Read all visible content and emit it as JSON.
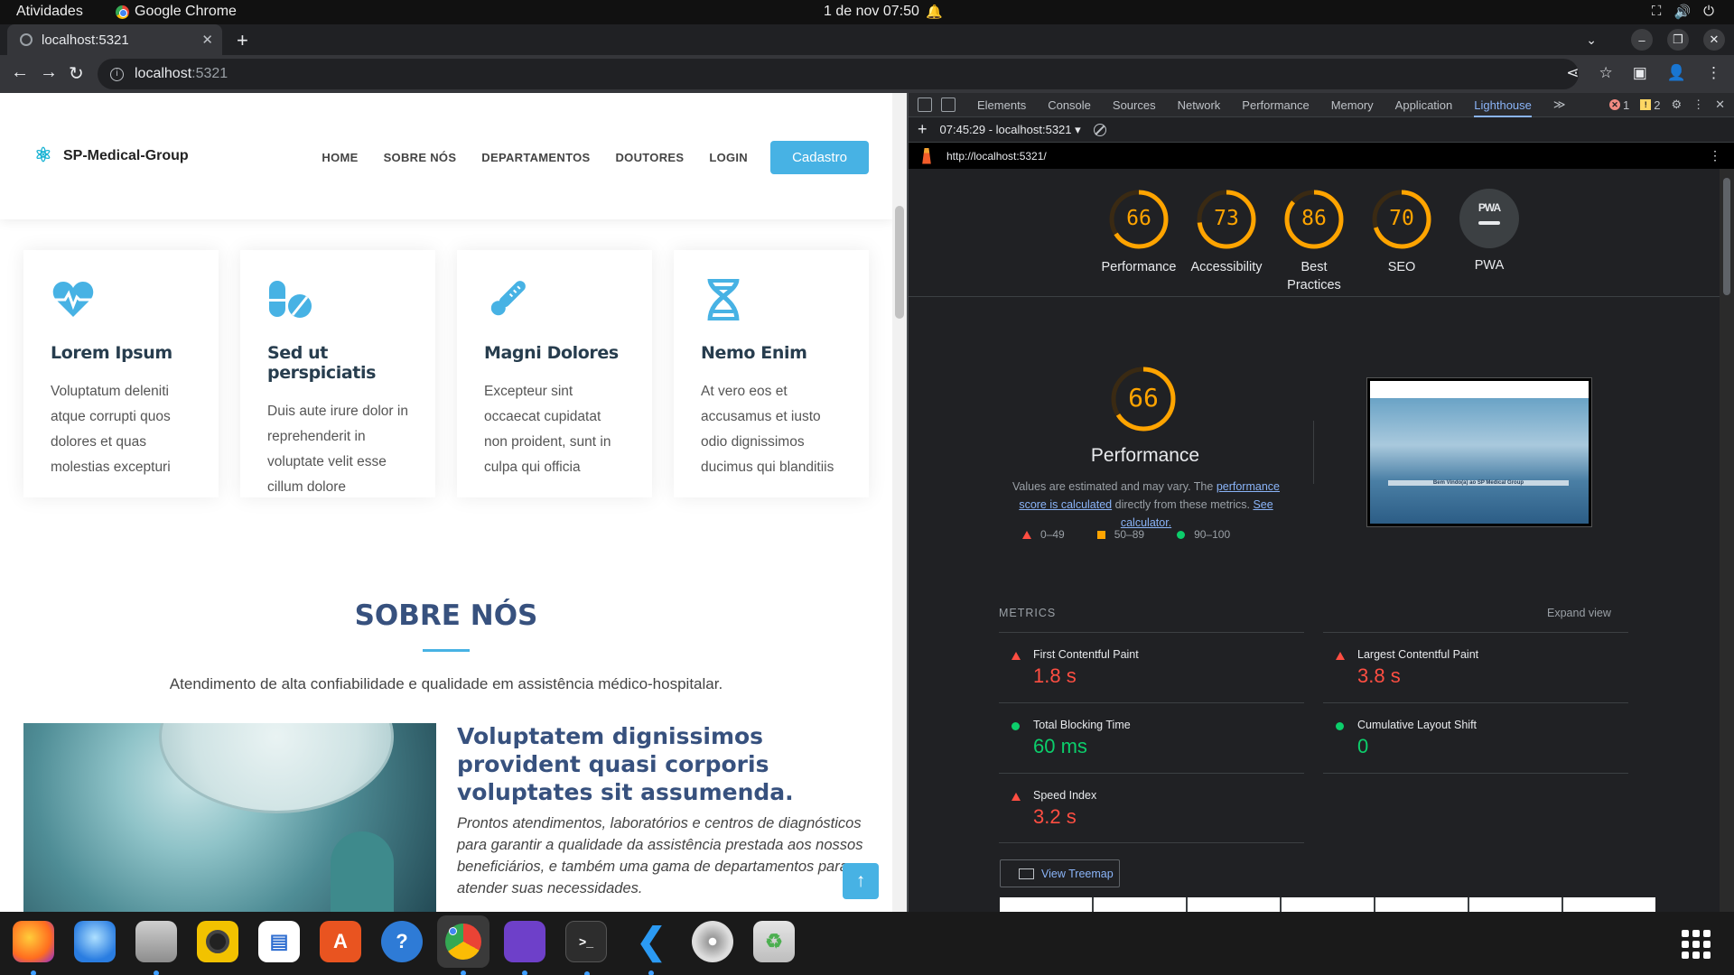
{
  "topbar": {
    "activities": "Atividades",
    "app_name": "Google Chrome",
    "clock": "1 de nov  07:50"
  },
  "browser": {
    "tab_title": "localhost:5321",
    "url_host": "localhost",
    "url_port": ":5321"
  },
  "site": {
    "logo": "SP-Medical-Group",
    "nav": [
      "HOME",
      "SOBRE NÓS",
      "DEPARTAMENTOS",
      "DOUTORES",
      "LOGIN"
    ],
    "cta": "Cadastro",
    "cards": [
      {
        "icon": "heartbeat-icon",
        "title": "Lorem Ipsum",
        "text": "Voluptatum deleniti atque corrupti quos dolores et quas molestias excepturi"
      },
      {
        "icon": "pills-icon",
        "title": "Sed ut perspiciatis",
        "text": "Duis aute irure dolor in reprehenderit in voluptate velit esse cillum dolore"
      },
      {
        "icon": "thermometer-icon",
        "title": "Magni Dolores",
        "text": "Excepteur sint occaecat cupidatat non proident, sunt in culpa qui officia"
      },
      {
        "icon": "dna-icon",
        "title": "Nemo Enim",
        "text": "At vero eos et accusamus et iusto odio dignissimos ducimus qui blanditiis"
      }
    ],
    "about": {
      "title": "SOBRE NÓS",
      "subtitle": "Atendimento de alta confiabilidade e qualidade em assistência médico-hospitalar.",
      "heading": "Voluptatem dignissimos provident quasi corporis voluptates sit assumenda.",
      "text": "Prontos atendimentos, laboratórios e centros de diagnósticos para garantir a qualidade da assistência prestada aos nossos beneficiários, e também uma gama de departamentos para atender suas necessidades."
    },
    "back_to_top": "↑"
  },
  "devtools": {
    "tabs": [
      "Elements",
      "Console",
      "Sources",
      "Network",
      "Performance",
      "Memory",
      "Application",
      "Lighthouse"
    ],
    "active_tab": "Lighthouse",
    "more_tabs": "≫",
    "errors": "1",
    "warnings": "2",
    "report_select": "07:45:29 - localhost:5321 ▾",
    "report_url": "http://localhost:5321/",
    "scores": [
      {
        "label": "Performance",
        "score": 66
      },
      {
        "label": "Accessibility",
        "score": 73
      },
      {
        "label": "Best Practices",
        "score": 86
      },
      {
        "label": "SEO",
        "score": 70
      }
    ],
    "pwa": {
      "label": "PWA",
      "badge": "PWA"
    },
    "performance": {
      "score": 66,
      "title": "Performance",
      "desc_1": "Values are estimated and may vary. The ",
      "desc_link_1": "performance score is calculated",
      "desc_2": " directly from these metrics. ",
      "desc_link_2": "See calculator.",
      "legend": [
        "0–49",
        "50–89",
        "90–100"
      ],
      "screenshot_caption": "Bem Vindo(a) ao SP Medical Group"
    },
    "metrics_heading": "METRICS",
    "expand_view": "Expand view",
    "metrics": [
      {
        "name": "First Contentful Paint",
        "value": "1.8 s",
        "status": "red"
      },
      {
        "name": "Largest Contentful Paint",
        "value": "3.8 s",
        "status": "red"
      },
      {
        "name": "Total Blocking Time",
        "value": "60 ms",
        "status": "green"
      },
      {
        "name": "Cumulative Layout Shift",
        "value": "0",
        "status": "green"
      },
      {
        "name": "Speed Index",
        "value": "3.2 s",
        "status": "red"
      }
    ],
    "treemap_button": "View Treemap"
  },
  "dock": [
    "firefox",
    "thunderbird",
    "files",
    "rhythmbox",
    "writer",
    "app-center",
    "help",
    "chrome",
    "github-desktop",
    "terminal",
    "vscode",
    "disc",
    "trash"
  ]
}
